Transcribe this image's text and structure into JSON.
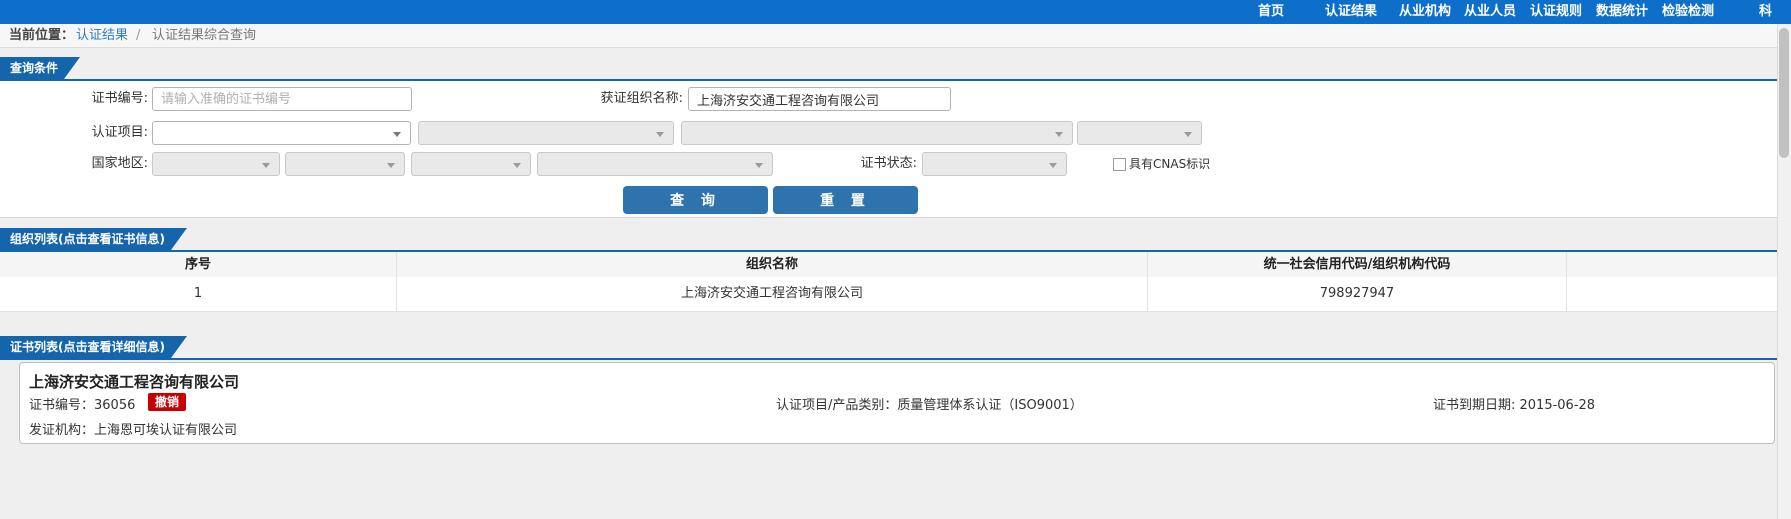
{
  "nav": {
    "items": [
      "首页",
      "认证结果",
      "从业机构",
      "从业人员",
      "认证规则",
      "数据统计",
      "检验检测",
      "科"
    ]
  },
  "breadcrumb": {
    "prefix": "当前位置：",
    "section_link": "认证结果",
    "separator": "/",
    "current": "认证结果综合查询"
  },
  "query": {
    "tab_title": "查询条件",
    "fields": {
      "cert_no_label": "证书编号:",
      "cert_no_placeholder": "请输入准确的证书编号",
      "org_name_label": "获证组织名称:",
      "org_name_value": "上海济安交通工程咨询有限公司",
      "project_label": "认证项目:",
      "region_label": "国家地区:",
      "status_label": "证书状态:",
      "cnas_label": "具有CNAS标识"
    },
    "buttons": {
      "search": "查 询",
      "reset": "重 置"
    }
  },
  "org_section": {
    "tab_title": "组织列表(点击查看证书信息)",
    "table": {
      "headers": [
        "序号",
        "组织名称",
        "统一社会信用代码/组织机构代码"
      ],
      "rows": [
        [
          "1",
          "上海济安交通工程咨询有限公司",
          "798927947"
        ]
      ]
    }
  },
  "cert_section": {
    "tab_title": "证书列表(点击查看详细信息)",
    "card": {
      "org_name": "上海济安交通工程咨询有限公司",
      "cert_no_label": "证书编号：",
      "cert_no": "36056",
      "status_badge": "撤销",
      "project_label": "认证项目/产品类别：",
      "project_value": "质量管理体系认证（ISO9001）",
      "expiry_label": "证书到期日期: ",
      "expiry_value": "2015-06-28",
      "issuer_label": "发证机构：",
      "issuer_value": "上海恩可埃认证有限公司"
    }
  },
  "colors": {
    "nav_blue": "#0d6fc9",
    "tab_blue": "#1565ad",
    "button_blue": "#2e73ae",
    "link_blue": "#2f7cc3",
    "badge_red": "#c80000"
  }
}
